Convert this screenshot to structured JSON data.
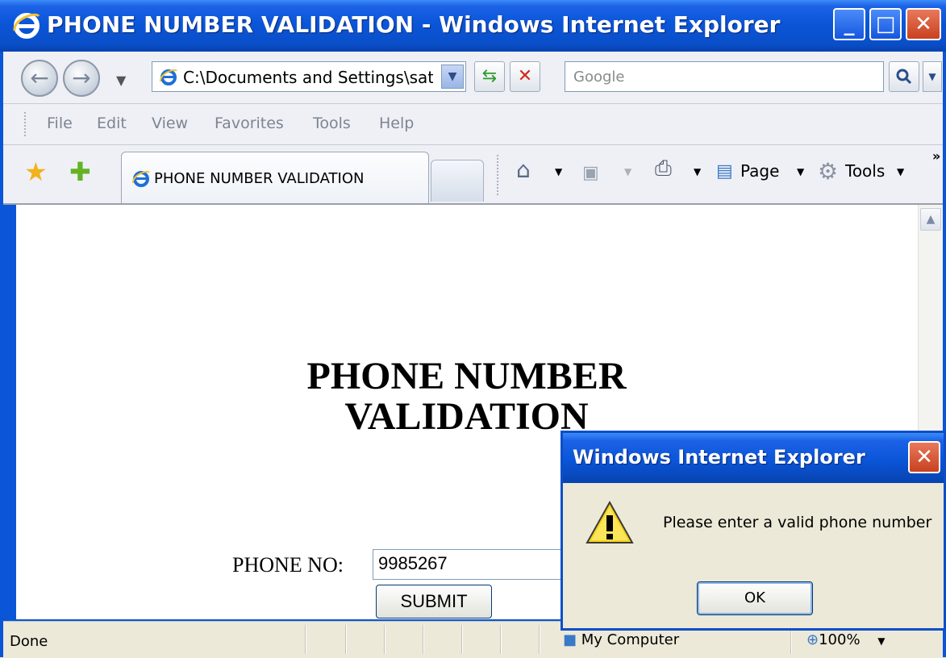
{
  "window": {
    "title": "PHONE NUMBER VALIDATION - Windows Internet Explorer"
  },
  "navbar": {
    "address": "C:\\Documents and Settings\\sati:",
    "search_placeholder": "Google"
  },
  "menu": {
    "items": [
      "File",
      "Edit",
      "View",
      "Favorites",
      "Tools",
      "Help"
    ]
  },
  "tabbar": {
    "tab_label": "PHONE NUMBER VALIDATION",
    "page_label": "Page",
    "tools_label": "Tools",
    "chevron": "»"
  },
  "content": {
    "heading_line1": "PHONE NUMBER",
    "heading_line2": "VALIDATION",
    "phone_label": "PHONE NO:",
    "phone_value": "9985267",
    "submit_label": "SUBMIT"
  },
  "status": {
    "text": "Done",
    "zone": "My Computer",
    "zoom": "100%"
  },
  "dialog": {
    "title": "Windows Internet Explorer",
    "message": "Please enter a valid phone number",
    "ok_label": "OK"
  },
  "colors": {
    "titlebar": "#0a55d8",
    "chrome": "#ece9d8",
    "close_red": "#d2411f"
  }
}
